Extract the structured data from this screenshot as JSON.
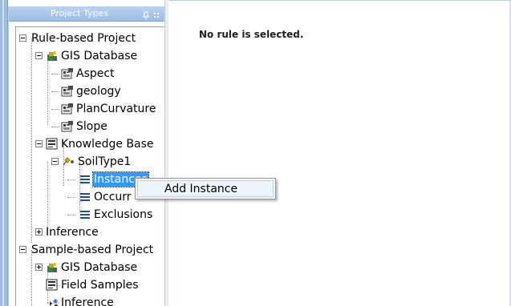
{
  "panel": {
    "title": "Project Types",
    "pin_icon": "pin-icon",
    "grip_icon": "grip-icon"
  },
  "main": {
    "message": "No rule is selected."
  },
  "tree": {
    "rule_project": "Rule-based Project",
    "gis_database": "GIS Database",
    "aspect": "Aspect",
    "geology": "geology",
    "plan_curvature": "PlanCurvature",
    "slope": "Slope",
    "knowledge_base": "Knowledge Base",
    "soil_type": "SoilType1",
    "instances": "Instances",
    "occurrences": "Occurr",
    "exclusions": "Exclusions",
    "inference": "Inference",
    "sample_project": "Sample-based Project",
    "sample_gis_database": "GIS Database",
    "field_samples": "Field Samples",
    "sample_inference": "Inference"
  },
  "context_menu": {
    "add_instance": "Add Instance"
  },
  "colors": {
    "selection": "#3399ff",
    "header": "#9dbde3",
    "menu_hover": "#eef4fb"
  }
}
